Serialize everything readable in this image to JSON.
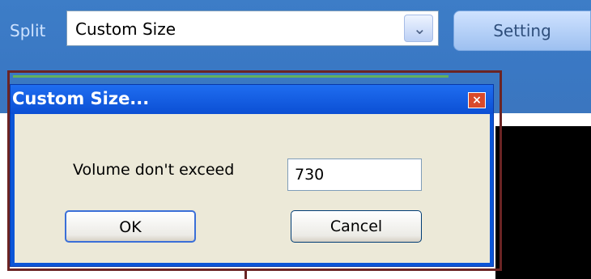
{
  "toolbar": {
    "split_label": "Split",
    "combo_value": "Custom Size",
    "combo_arrow": "chevron-down",
    "setting_label": "Setting"
  },
  "dialog": {
    "title": "Custom Size...",
    "close_icon": "×",
    "volume_label": "Volume don't exceed",
    "volume_value": "730",
    "ok_label": "OK",
    "cancel_label": "Cancel"
  },
  "colors": {
    "toolbar_bg": "#3a78c4",
    "dialog_title_bg": "#0b4fd4",
    "dialog_body_bg": "#ece9d8",
    "frame": "#6b2424",
    "close_button": "#d94a2b"
  }
}
